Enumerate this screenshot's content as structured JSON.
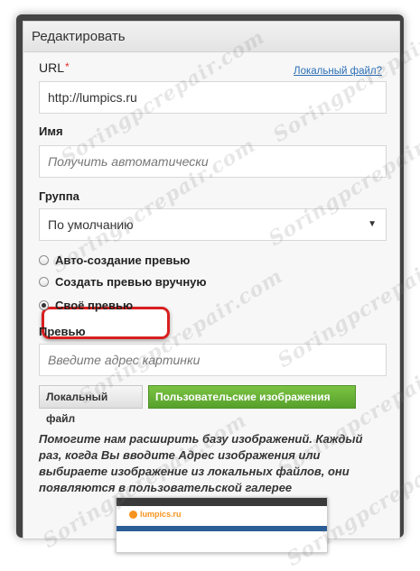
{
  "dialog": {
    "title": "Редактировать",
    "url_label": "URL",
    "required_mark": "*",
    "local_file_link": "Локальный файл?",
    "url_value": "http://lumpics.ru",
    "name_label": "Имя",
    "name_placeholder": "Получить автоматически",
    "group_label": "Группа",
    "group_selected": "По умолчанию",
    "radio_options": [
      {
        "label": "Авто-создание превью",
        "checked": false
      },
      {
        "label": "Создать превью вручную",
        "checked": false
      },
      {
        "label": "Своё превью",
        "checked": true
      }
    ],
    "preview_label": "Превью",
    "preview_placeholder": "Введите адрес картинки",
    "local_file_button": "Локальный файл",
    "user_images_button": "Пользовательские изображения",
    "help_text": "Помогите нам расширить базу изображений. Каждый раз, когда Вы вводите Адрес изображения или выбираете изображение из локальных файлов, они появляются в пользовательской галерее"
  },
  "preview_thumbnail": {
    "logo_text": "lumpics.ru"
  },
  "watermark": {
    "text": "Soringpcrepair.com"
  },
  "colors": {
    "accent_green": "#6bb33a",
    "highlight_red": "#d91f1f",
    "link_blue": "#2a6fb5"
  }
}
